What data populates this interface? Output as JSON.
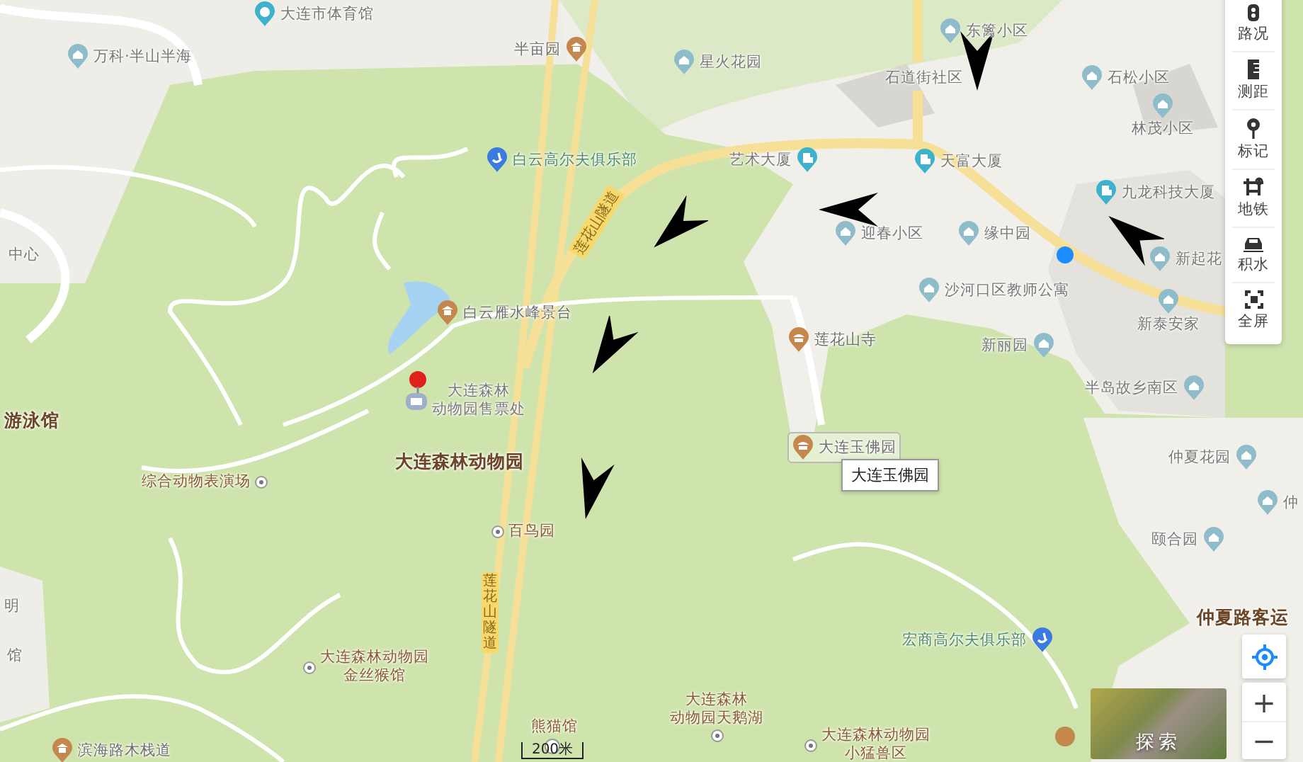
{
  "map": {
    "places": [
      {
        "lines": [
          "大连市体育馆"
        ],
        "kind": "sport",
        "hovered": false
      },
      {
        "lines": [
          "万科·半山半海"
        ],
        "kind": "house",
        "hovered": false
      },
      {
        "lines": [
          "半亩园"
        ],
        "kind": "scenic",
        "hovered": false
      },
      {
        "lines": [
          "星火花园"
        ],
        "kind": "house",
        "hovered": false
      },
      {
        "lines": [
          "东篱小区"
        ],
        "kind": "house",
        "hovered": false
      },
      {
        "lines": [
          "石道街社区"
        ],
        "kind": "area",
        "hovered": false
      },
      {
        "lines": [
          "石松小区"
        ],
        "kind": "house",
        "hovered": false
      },
      {
        "lines": [
          "林茂小区"
        ],
        "kind": "house",
        "hovered": false
      },
      {
        "lines": [
          "白云高尔夫俱乐部"
        ],
        "kind": "golf",
        "hovered": false
      },
      {
        "lines": [
          "艺术大厦"
        ],
        "kind": "building",
        "hovered": false
      },
      {
        "lines": [
          "天富大厦"
        ],
        "kind": "building",
        "hovered": false
      },
      {
        "lines": [
          "九龙科技大厦"
        ],
        "kind": "building",
        "hovered": false
      },
      {
        "lines": [
          "迎春小区"
        ],
        "kind": "house",
        "hovered": false
      },
      {
        "lines": [
          "缘中园"
        ],
        "kind": "house",
        "hovered": false
      },
      {
        "lines": [
          "新起花"
        ],
        "kind": "house",
        "hovered": false
      },
      {
        "lines": [
          "沙河口区教师公寓"
        ],
        "kind": "house",
        "hovered": false
      },
      {
        "lines": [
          "新泰安家"
        ],
        "kind": "house",
        "hovered": false
      },
      {
        "lines": [
          "莲花山寺"
        ],
        "kind": "temple",
        "hovered": false
      },
      {
        "lines": [
          "新丽园"
        ],
        "kind": "house",
        "hovered": false
      },
      {
        "lines": [
          "半岛故乡南区"
        ],
        "kind": "house",
        "hovered": false
      },
      {
        "lines": [
          "中心"
        ],
        "kind": "area",
        "hovered": false
      },
      {
        "lines": [
          "白云雁水峰景台"
        ],
        "kind": "scenic",
        "hovered": false
      },
      {
        "lines": [
          "大连森林",
          "动物园售票处"
        ],
        "kind": "ticket",
        "hovered": false
      },
      {
        "lines": [
          "游泳馆"
        ],
        "kind": "landmark",
        "hovered": false
      },
      {
        "lines": [
          "大连森林动物园"
        ],
        "kind": "landmark",
        "hovered": false
      },
      {
        "lines": [
          "综合动物表演场"
        ],
        "kind": "spot",
        "hovered": false
      },
      {
        "lines": [
          "大连玉佛园"
        ],
        "kind": "temple",
        "hovered": true
      },
      {
        "lines": [
          "仲夏花园"
        ],
        "kind": "house",
        "hovered": false
      },
      {
        "lines": [
          "仲"
        ],
        "kind": "house",
        "hovered": false
      },
      {
        "lines": [
          "颐合园"
        ],
        "kind": "house",
        "hovered": false
      },
      {
        "lines": [
          "百鸟园"
        ],
        "kind": "spot",
        "hovered": false
      },
      {
        "lines": [
          "明"
        ],
        "kind": "area",
        "hovered": false
      },
      {
        "lines": [
          "馆"
        ],
        "kind": "area",
        "hovered": false
      },
      {
        "lines": [
          "仲夏路客运"
        ],
        "kind": "landmark",
        "hovered": false
      },
      {
        "lines": [
          "宏商高尔夫俱乐部"
        ],
        "kind": "golf",
        "hovered": false
      },
      {
        "lines": [
          "大连森林动物园",
          "金丝猴馆"
        ],
        "kind": "spot",
        "hovered": false
      },
      {
        "lines": [
          "滨海路木栈道"
        ],
        "kind": "scenic",
        "hovered": false
      },
      {
        "lines": [
          "熊猫馆"
        ],
        "kind": "zoo-text",
        "hovered": false
      },
      {
        "lines": [
          "大连森林",
          "动物园天鹅湖"
        ],
        "kind": "spot",
        "hovered": false
      },
      {
        "lines": [
          "大连森林动物园",
          "小猛兽区"
        ],
        "kind": "spot",
        "hovered": false
      }
    ],
    "road_labels": [
      "莲花山隧道",
      "莲花山隧道"
    ],
    "tooltip": "大连玉佛园",
    "scale": "200米"
  },
  "toolbar": [
    {
      "label": "路况",
      "kind": "traffic"
    },
    {
      "label": "测距",
      "kind": "ruler"
    },
    {
      "label": "标记",
      "kind": "marker"
    },
    {
      "label": "地铁",
      "kind": "subway"
    },
    {
      "label": "积水",
      "kind": "flood"
    },
    {
      "label": "全屏",
      "kind": "fullscreen"
    }
  ],
  "zoom": {
    "in": "+",
    "out": "−"
  },
  "explore": {
    "label": "探索"
  }
}
